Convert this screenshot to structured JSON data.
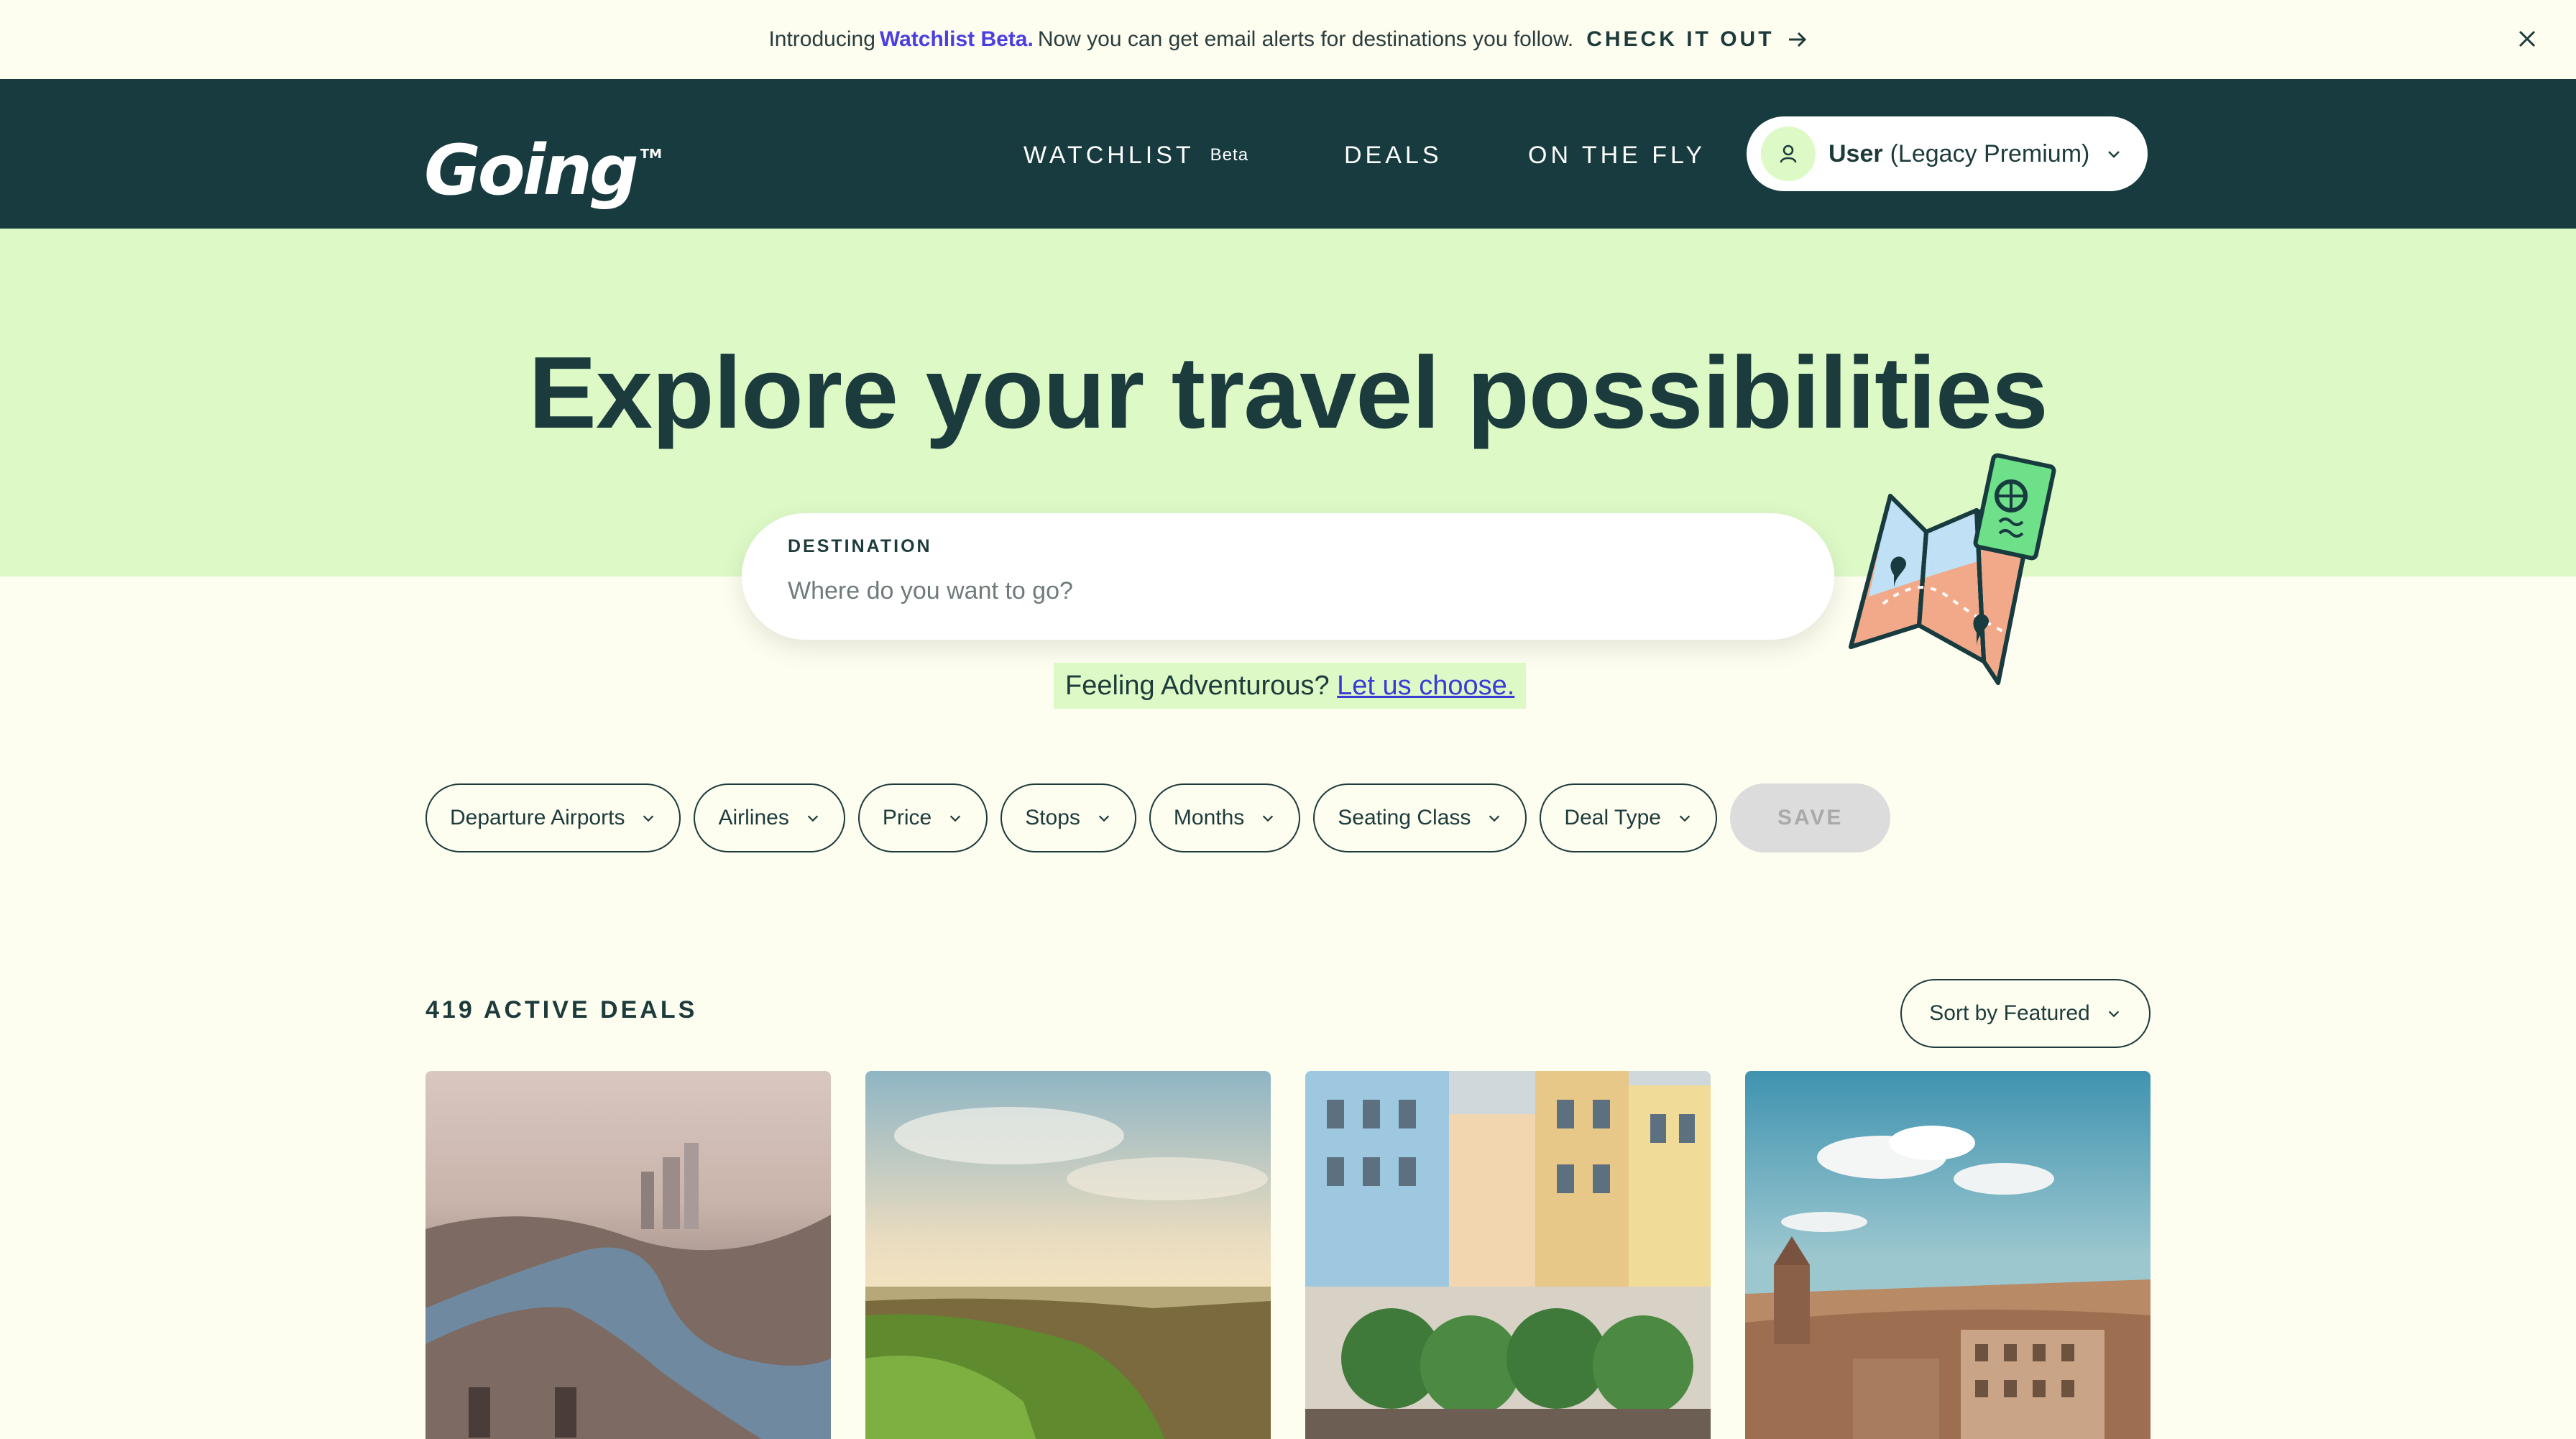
{
  "announcement": {
    "intro": "Introducing",
    "highlight": "Watchlist Beta.",
    "text": "Now you can get email alerts for destinations you follow.",
    "cta": "CHECK IT OUT"
  },
  "nav": {
    "logo": "Going",
    "logo_tm": "TM",
    "items": [
      {
        "label": "WATCHLIST",
        "badge": "Beta"
      },
      {
        "label": "DEALS"
      },
      {
        "label": "ON THE FLY"
      }
    ],
    "user": {
      "name": "User",
      "plan": "(Legacy Premium)"
    }
  },
  "hero": {
    "title": "Explore your travel possibilities",
    "search_label": "DESTINATION",
    "search_placeholder": "Where do you want to go?",
    "feeling_text": "Feeling Adventurous?",
    "feeling_link": "Let us choose."
  },
  "filters": [
    "Departure Airports",
    "Airlines",
    "Price",
    "Stops",
    "Months",
    "Seating Class",
    "Deal Type"
  ],
  "save_label": "SAVE",
  "deals": {
    "count_label": "419 ACTIVE DEALS",
    "sort_label": "Sort by Featured"
  },
  "colors": {
    "nav_bg": "#173b3e",
    "hero_bg": "#dcf9c6",
    "page_bg": "#fdfdf0",
    "accent": "#4b3ee0"
  }
}
